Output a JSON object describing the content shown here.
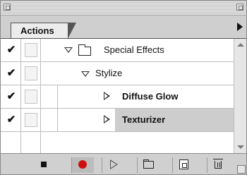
{
  "panel": {
    "tab_label": "Actions"
  },
  "actions": [
    {
      "name": "Special Effects",
      "checked": "✔",
      "type": "set",
      "expanded": true
    },
    {
      "name": "Stylize",
      "checked": "✔",
      "type": "action",
      "expanded": true
    },
    {
      "name": "Diffuse Glow",
      "checked": "✔",
      "type": "command",
      "expanded": false,
      "selected": false
    },
    {
      "name": "Texturizer",
      "checked": "✔",
      "type": "command",
      "expanded": false,
      "selected": true
    }
  ],
  "toolbar": {
    "buttons": [
      "stop-icon",
      "record-icon",
      "play-icon",
      "folder-icon",
      "new-action-icon",
      "trash-icon"
    ]
  },
  "colors": {
    "record": "#cc1010",
    "selection": "#cdcdcd",
    "panel": "#d6d6d6"
  }
}
